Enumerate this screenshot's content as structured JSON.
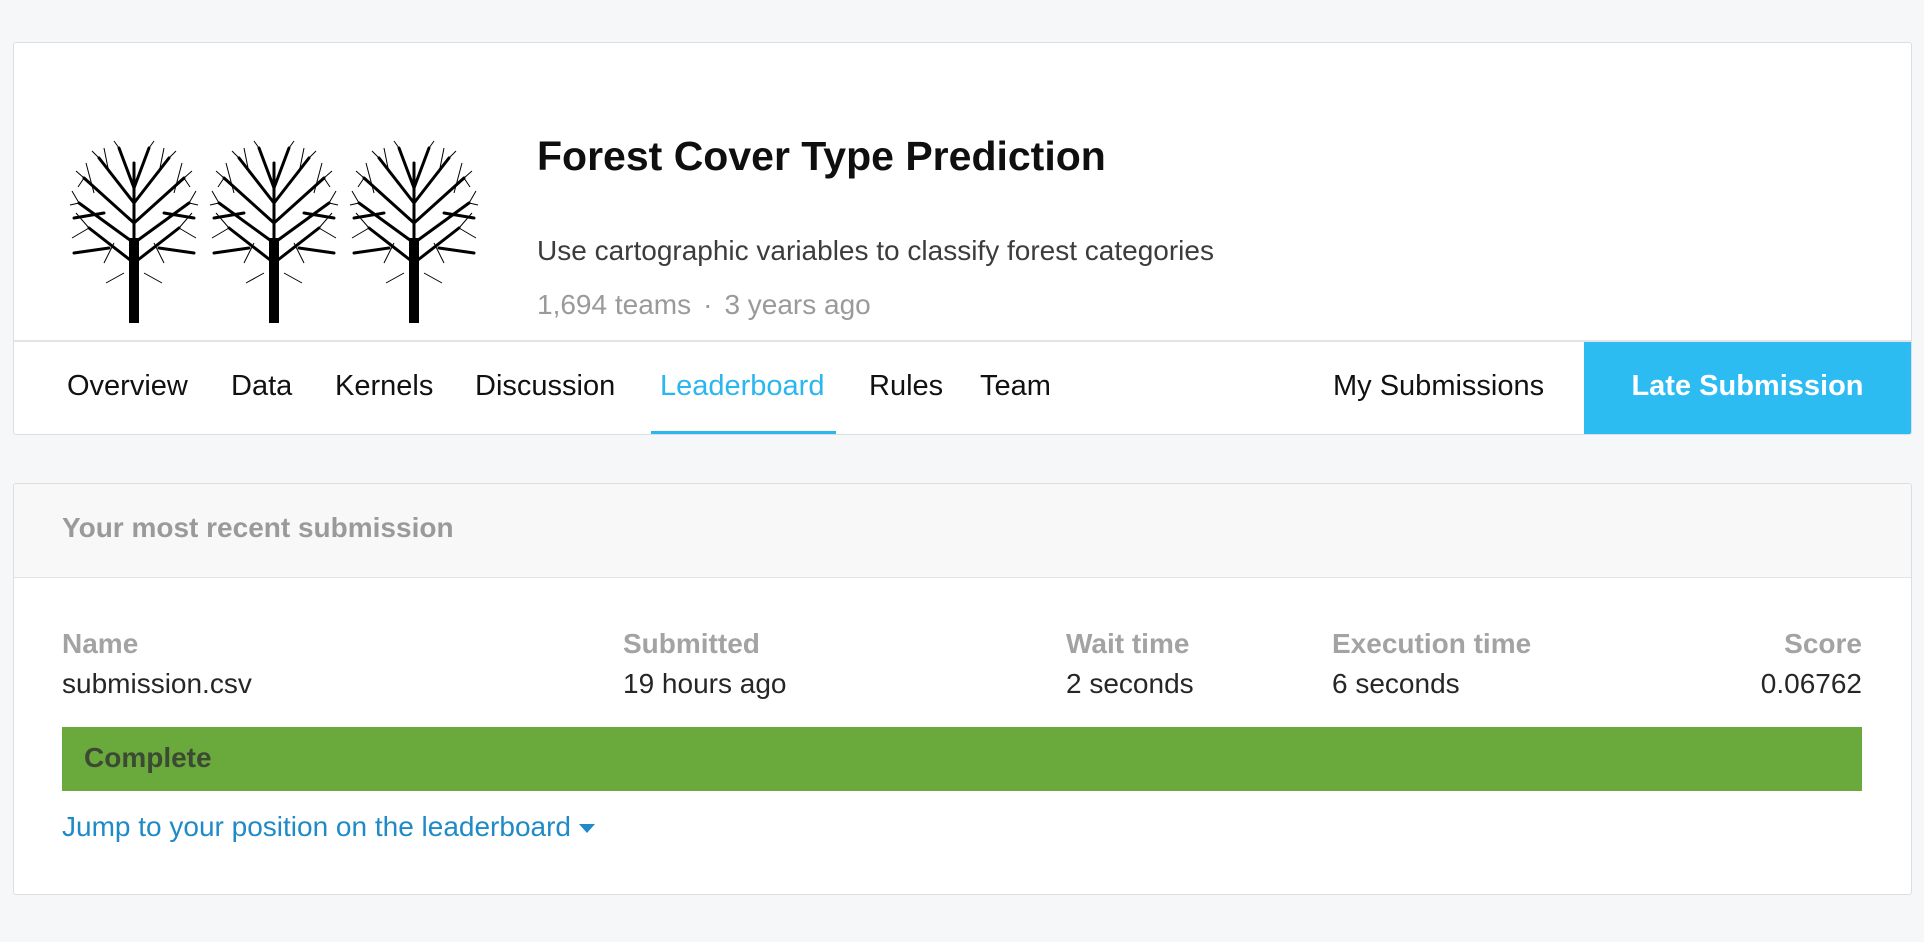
{
  "competition": {
    "title": "Forest Cover Type Prediction",
    "subtitle": "Use cartographic variables to classify forest categories",
    "teams": "1,694 teams",
    "separator": "·",
    "age": "3 years ago"
  },
  "tabs": [
    {
      "label": "Overview",
      "active": false
    },
    {
      "label": "Data",
      "active": false
    },
    {
      "label": "Kernels",
      "active": false
    },
    {
      "label": "Discussion",
      "active": false
    },
    {
      "label": "Leaderboard",
      "active": true
    },
    {
      "label": "Rules",
      "active": false
    },
    {
      "label": "Team",
      "active": false
    }
  ],
  "actions": {
    "my_submissions": "My Submissions",
    "late_submission": "Late Submission"
  },
  "submission": {
    "header": "Your most recent submission",
    "columns": [
      {
        "label": "Name",
        "value": "submission.csv"
      },
      {
        "label": "Submitted",
        "value": "19 hours ago"
      },
      {
        "label": "Wait time",
        "value": "2 seconds"
      },
      {
        "label": "Execution time",
        "value": "6 seconds"
      },
      {
        "label": "Score",
        "value": "0.06762"
      }
    ],
    "status": "Complete",
    "jump_link": "Jump to your position on the leaderboard"
  },
  "colors": {
    "accent": "#2cbcf2",
    "status_complete": "#6aaa3d",
    "link": "#1f8ac7"
  },
  "icons": {
    "thumbnail": "three-trees-image",
    "jump_caret": "caret-down-icon"
  }
}
